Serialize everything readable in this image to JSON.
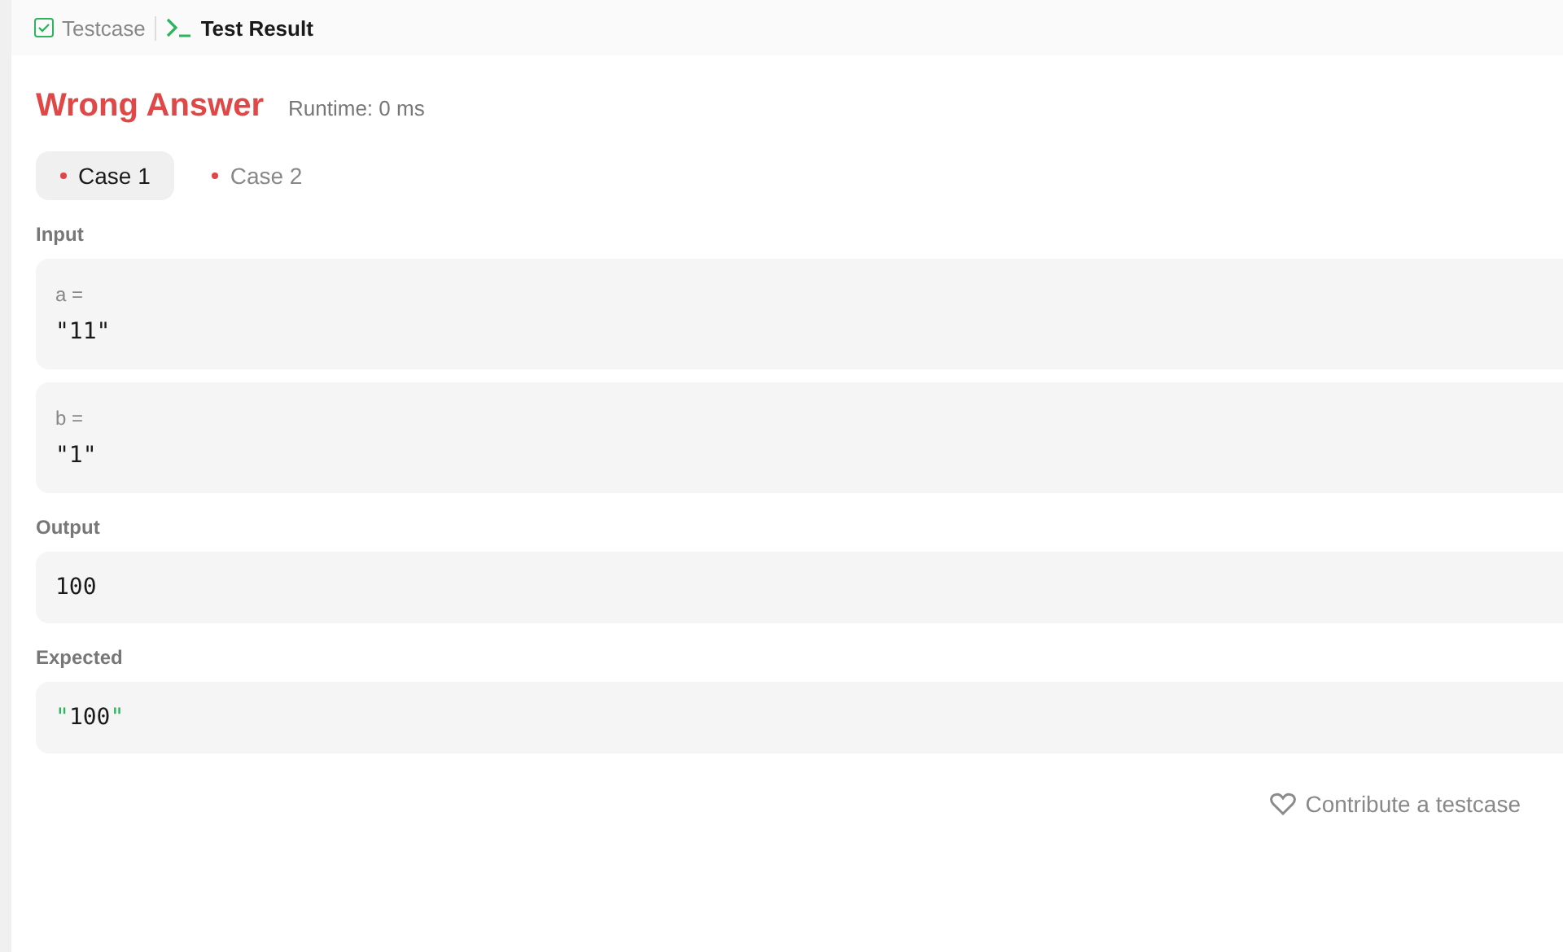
{
  "tabs": [
    {
      "label": "Testcase",
      "kind": "testcase",
      "selected": false
    },
    {
      "label": "Test Result",
      "kind": "result",
      "selected": true
    }
  ],
  "verdict": "Wrong Answer",
  "runtime": "Runtime: 0 ms",
  "cases": [
    {
      "label": "Case 1",
      "selected": true
    },
    {
      "label": "Case 2",
      "selected": false
    }
  ],
  "input_label": "Input",
  "inputs": [
    {
      "name": "a =",
      "value": "\"11\""
    },
    {
      "name": "b =",
      "value": "\"1\""
    }
  ],
  "output_label": "Output",
  "output": "100",
  "expected_label": "Expected",
  "expected": {
    "value": "\"100\"",
    "diff": true
  },
  "contribute": "Contribute a testcase"
}
